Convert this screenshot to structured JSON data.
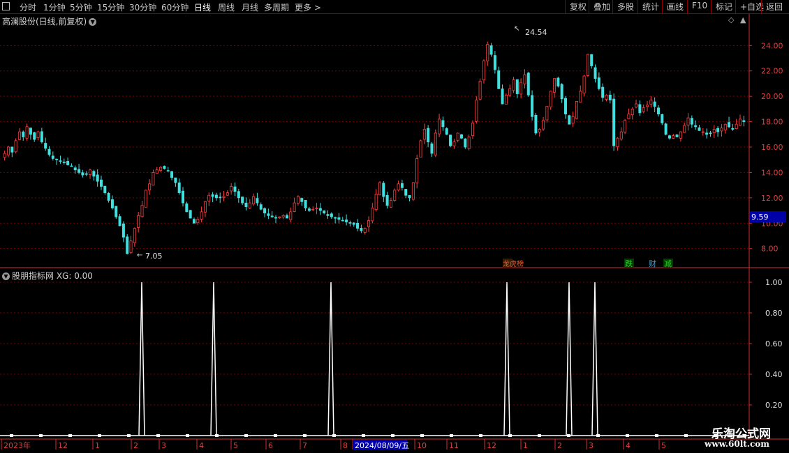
{
  "toolbar": {
    "left_items": [
      "分时",
      "1分钟",
      "5分钟",
      "15分钟",
      "30分钟",
      "60分钟",
      "日线",
      "周线",
      "月线",
      "多周期",
      "更多 >"
    ],
    "active": "日线",
    "right_items": [
      "复权",
      "叠加",
      "多股",
      "统计",
      "画线",
      "F10",
      "标记",
      "+自选",
      "返回"
    ]
  },
  "main_panel": {
    "title": "高澜股份(日线,前复权)",
    "high_label": "24.54",
    "low_label": "7.05",
    "current_price": "9.59",
    "y_ticks": [
      "24.00",
      "22.00",
      "20.00",
      "18.00",
      "16.00",
      "14.00",
      "12.00",
      "10.00",
      "8.00"
    ],
    "event_markers": [
      {
        "text": "龙虎榜",
        "color": "#e06030"
      },
      {
        "text": "跌",
        "color": "#30d030"
      },
      {
        "text": "财",
        "color": "#30a0e0"
      },
      {
        "text": "减",
        "color": "#30d030"
      }
    ]
  },
  "indicator_panel": {
    "title": "股朋指标网 XG: 0.00",
    "y_ticks": [
      "1.00",
      "0.80",
      "0.60",
      "0.40",
      "0.20"
    ]
  },
  "date_axis": {
    "labels": [
      "2023年",
      "12",
      "1",
      "2",
      "3",
      "4",
      "5",
      "6",
      "7",
      "8",
      "2024/08/09/五",
      "10",
      "11",
      "12",
      "1",
      "2",
      "3",
      "4",
      "5"
    ]
  },
  "watermark": {
    "line1": "乐淘公式网",
    "line2": "www.60lt.com"
  },
  "colors": {
    "up": "#ff4040",
    "down": "#40e0e0",
    "grid": "#7a0000",
    "axis": "#d03030",
    "signal": "#ffffff"
  },
  "chart_data": {
    "type": "candlestick",
    "price_range": [
      6.5,
      25.5
    ],
    "closes": [
      15.5,
      16.0,
      15.6,
      16.5,
      17.2,
      16.8,
      17.6,
      17.0,
      16.6,
      17.2,
      16.4,
      15.9,
      15.4,
      15.1,
      15.0,
      14.9,
      14.8,
      14.6,
      14.5,
      14.2,
      14.0,
      13.8,
      13.9,
      14.2,
      13.7,
      13.3,
      12.9,
      12.4,
      11.8,
      11.2,
      10.5,
      9.8,
      8.9,
      7.6,
      8.6,
      9.6,
      10.6,
      11.4,
      12.6,
      13.1,
      14.0,
      14.2,
      14.4,
      14.3,
      14.1,
      13.6,
      13.2,
      12.4,
      11.6,
      10.9,
      10.4,
      10.0,
      10.3,
      10.9,
      11.7,
      12.2,
      12.1,
      12.0,
      12.0,
      12.1,
      12.4,
      12.9,
      12.5,
      12.0,
      11.6,
      11.3,
      11.6,
      12.1,
      11.6,
      11.1,
      10.8,
      10.6,
      10.5,
      10.4,
      10.5,
      10.6,
      10.4,
      10.9,
      11.6,
      12.1,
      11.7,
      11.2,
      11.0,
      11.1,
      11.2,
      11.0,
      10.8,
      10.6,
      10.5,
      10.4,
      10.3,
      10.2,
      10.1,
      10.0,
      9.9,
      9.6,
      9.4,
      9.6,
      10.2,
      11.2,
      12.3,
      13.2,
      12.1,
      11.4,
      11.8,
      12.6,
      13.1,
      12.8,
      12.2,
      12.0,
      13.2,
      15.1,
      16.5,
      17.4,
      16.4,
      15.5,
      17.1,
      18.2,
      17.6,
      17.0,
      16.1,
      16.4,
      17.1,
      16.7,
      16.0,
      16.8,
      17.9,
      19.7,
      21.2,
      22.8,
      24.1,
      23.3,
      22.1,
      20.6,
      19.4,
      20.1,
      20.6,
      21.3,
      20.2,
      21.1,
      21.7,
      20.1,
      18.4,
      17.1,
      17.4,
      18.1,
      19.2,
      20.4,
      21.4,
      20.8,
      19.8,
      18.6,
      17.8,
      18.4,
      19.6,
      20.4,
      21.6,
      23.3,
      22.4,
      21.4,
      20.6,
      19.9,
      20.1,
      19.7,
      16.1,
      16.7,
      17.2,
      18.1,
      18.6,
      19.0,
      19.4,
      18.7,
      19.1,
      19.3,
      19.7,
      19.2,
      18.6,
      17.9,
      17.0,
      16.7,
      16.9,
      16.8,
      17.2,
      17.7,
      18.3,
      17.8,
      17.6,
      17.3,
      17.2,
      17.0,
      17.1,
      17.4,
      17.2,
      17.5,
      17.8,
      17.6,
      17.4,
      17.8,
      18.2,
      18.0
    ]
  }
}
